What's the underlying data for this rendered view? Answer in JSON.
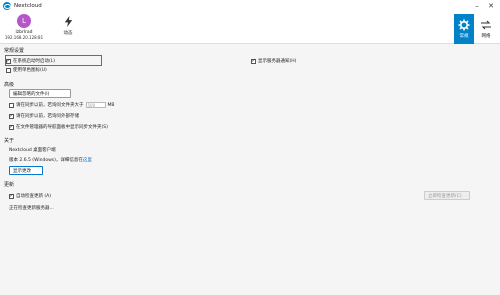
{
  "window": {
    "title": "Nextcloud"
  },
  "account": {
    "avatar_letter": "L",
    "name": "lzbrlrad",
    "address": "192.168.20.128:81"
  },
  "activity_label": "动态",
  "tabs": {
    "general": "常规",
    "network": "网络"
  },
  "general_settings": {
    "title": "常规设置",
    "start_on_login": "在系统启动时启动(L)",
    "show_server_notifications": "显示服务器通知(H)",
    "mono_icons": "使用单色图标(U)"
  },
  "advanced": {
    "title": "高级",
    "edit_ignored_button": "编辑忽略的文件(I)",
    "ask_before_sync_large": "请在同步以前，若询问文件夹大于",
    "large_size": "500",
    "size_unit": "MB",
    "ask_before_sync_external": "请在同步以前，若询问外部存储",
    "show_in_explorer": "在文件管理器的导航面板中显示同步文件夹(S)"
  },
  "about": {
    "title": "关于",
    "product": "Nextcloud 桌面客户端",
    "version_prefix": "版本 2.6.5 (Windows)，详细信息在",
    "version_link": "这里",
    "show_log_button": "显示更改"
  },
  "updates": {
    "title": "更新",
    "auto_check": "自动检查更新 (A)",
    "check_now_button": "立即检查更新(C)",
    "status": "正在检查更新服务器..."
  },
  "colors": {
    "accent": "#0082c9",
    "avatar": "#b357c9",
    "highlight": "#e0393e"
  }
}
